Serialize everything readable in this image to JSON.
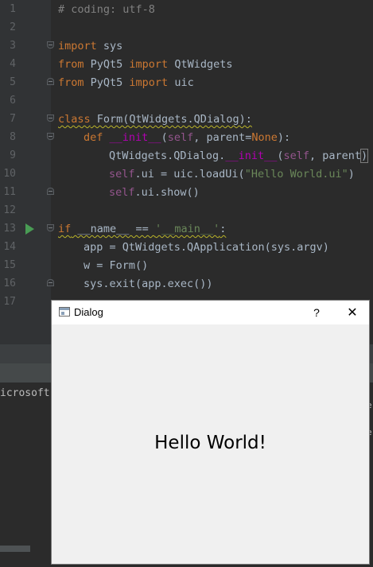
{
  "editor": {
    "lines": [
      {
        "n": "1"
      },
      {
        "n": "2"
      },
      {
        "n": "3"
      },
      {
        "n": "4"
      },
      {
        "n": "5"
      },
      {
        "n": "6"
      },
      {
        "n": "7"
      },
      {
        "n": "8"
      },
      {
        "n": "9"
      },
      {
        "n": "10"
      },
      {
        "n": "11"
      },
      {
        "n": "12"
      },
      {
        "n": "13"
      },
      {
        "n": "14"
      },
      {
        "n": "15"
      },
      {
        "n": "16"
      },
      {
        "n": "17"
      }
    ],
    "code": {
      "l1": "# coding: utf-8",
      "l3_kw": "import",
      "l3_rest": " sys",
      "l4_from": "from",
      "l4_mod": " PyQt5 ",
      "l4_imp": "import",
      "l4_rest": " QtWidgets",
      "l5_from": "from",
      "l5_mod": " PyQt5 ",
      "l5_imp": "import",
      "l5_rest": " uic",
      "l7_class": "class",
      "l7_rest": " Form(QtWidgets.QDialog):",
      "l8_def": "def",
      "l8_name": "__init__",
      "l8_open": "(",
      "l8_self": "self",
      "l8_mid": ", parent=",
      "l8_none": "None",
      "l8_end": "):",
      "l9_a": "QtWidgets.QDialog.",
      "l9_init": "__init__",
      "l9_open": "(",
      "l9_self": "self",
      "l9_mid": ", parent",
      "l9_close": ")",
      "l10_self": "self",
      "l10_mid": ".ui = uic.loadUi(",
      "l10_str": "\"Hello World.ui\"",
      "l10_end": ")",
      "l11_self": "self",
      "l11_rest": ".ui.show()",
      "l13_if": "if",
      "l13_mid": " __name__ == ",
      "l13_str": "'__main__'",
      "l13_end": ":",
      "l14": "app = QtWidgets.QApplication(sys.argv)",
      "l15": "w = Form()",
      "l16": "sys.exit(app.exec())"
    }
  },
  "console": {
    "text": "icrosoft",
    "right_mark_1": "e",
    "right_mark_2": "e"
  },
  "dialog": {
    "title": "Dialog",
    "help_label": "?",
    "close_label": "✕",
    "label": "Hello World!"
  },
  "colors": {
    "editor_bg": "#2b2b2b",
    "keyword": "#cc7832",
    "string": "#6a8759",
    "function": "#ffc66d",
    "run_icon": "#499c54"
  }
}
